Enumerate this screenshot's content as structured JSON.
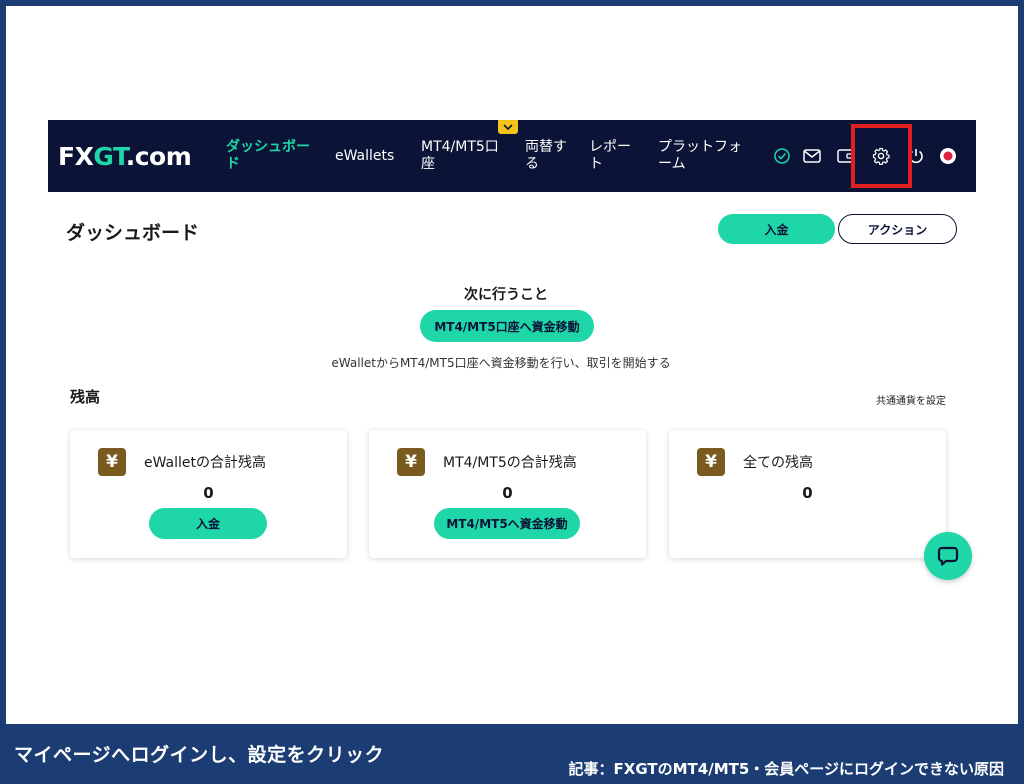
{
  "navbar": {
    "logo_prefix": "FX",
    "logo_accent": "GT",
    "logo_suffix": ".com",
    "items": [
      {
        "label": "ダッシュボード",
        "active": true
      },
      {
        "label": "eWallets"
      },
      {
        "label": "MT4/MT5口座"
      },
      {
        "label": "両替する"
      },
      {
        "label": "レポート"
      },
      {
        "label": "プラットフォーム"
      }
    ],
    "icons": [
      "check-circle-icon",
      "mail-icon",
      "wallet-icon",
      "gear-icon",
      "power-icon",
      "record-icon"
    ]
  },
  "page": {
    "title": "ダッシュボード",
    "deposit_label": "入金",
    "action_label": "アクション"
  },
  "next_step": {
    "title": "次に行うこと",
    "button_label": "MT4/MT5口座へ資金移動",
    "description": "eWalletからMT4/MT5口座へ資金移動を行い、取引を開始する"
  },
  "balance": {
    "title": "残高",
    "currency_link": "共通通貨を設定",
    "cards": [
      {
        "label": "eWalletの合計残高",
        "value": "0",
        "button": "入金"
      },
      {
        "label": "MT4/MT5の合計残高",
        "value": "0",
        "button": "MT4/MT5へ資金移動"
      },
      {
        "label": "全ての残高",
        "value": "0"
      }
    ],
    "currency_symbol": "¥"
  },
  "captions": {
    "left": "マイページへログインし、設定をクリック",
    "right": "記事：FXGTのMT4/MT5・会員ページにログインできない原因"
  },
  "colors": {
    "accent": "#1fd6a8",
    "navbar": "#0b1436",
    "frame": "#1c3d73",
    "highlight": "#e02020",
    "yen_badge": "#7a5a1e"
  }
}
